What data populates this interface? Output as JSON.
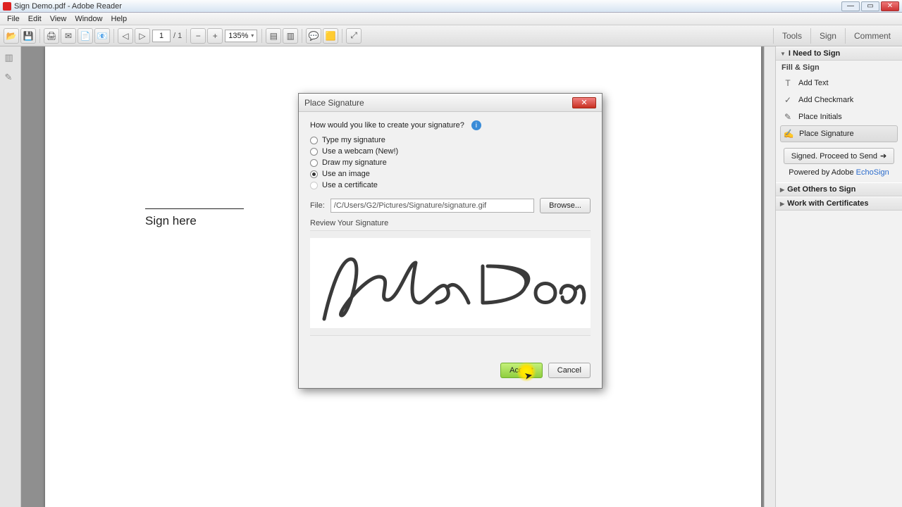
{
  "window": {
    "title": "Sign Demo.pdf - Adobe Reader",
    "min_label": "—",
    "max_label": "▭",
    "close_label": "✕"
  },
  "menubar": [
    "File",
    "Edit",
    "View",
    "Window",
    "Help"
  ],
  "toolbar": {
    "page_current": "1",
    "page_total": "/ 1",
    "zoom": "135%"
  },
  "tool_tabs": {
    "tools": "Tools",
    "sign": "Sign",
    "comment": "Comment"
  },
  "sidebar": {
    "section1": "I Need to Sign",
    "sub1": "Fill & Sign",
    "items": [
      {
        "icon": "T",
        "label": "Add Text"
      },
      {
        "icon": "✓",
        "label": "Add Checkmark"
      },
      {
        "icon": "✎",
        "label": "Place Initials"
      },
      {
        "icon": "✍",
        "label": "Place Signature"
      }
    ],
    "proceed": "Signed. Proceed to Send",
    "powered": "Powered by Adobe ",
    "powered_link": "EchoSign",
    "section2": "Get Others to Sign",
    "section3": "Work with Certificates"
  },
  "document": {
    "sign_here": "Sign here"
  },
  "dialog": {
    "title": "Place Signature",
    "question": "How would you like to create your signature?",
    "options": [
      {
        "label": "Type my signature",
        "selected": false,
        "disabled": false
      },
      {
        "label": "Use a webcam (New!)",
        "selected": false,
        "disabled": false
      },
      {
        "label": "Draw my signature",
        "selected": false,
        "disabled": false
      },
      {
        "label": "Use an image",
        "selected": true,
        "disabled": false
      },
      {
        "label": "Use a certificate",
        "selected": false,
        "disabled": true
      }
    ],
    "file_label": "File:",
    "file_path": "/C/Users/G2/Pictures/Signature/signature.gif",
    "browse": "Browse...",
    "review": "Review Your Signature",
    "accept": "Accept",
    "cancel": "Cancel",
    "close_label": "✕"
  }
}
